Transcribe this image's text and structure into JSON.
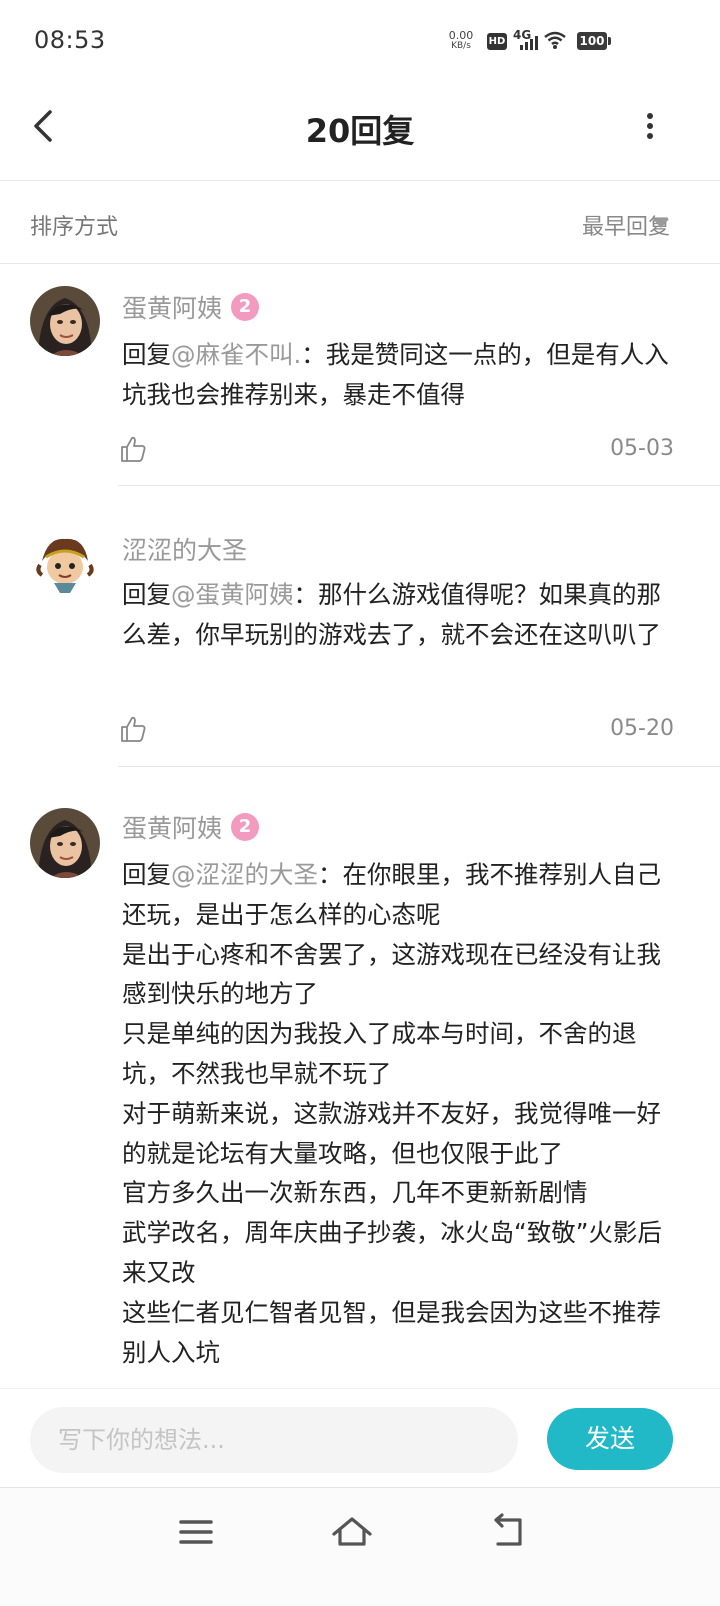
{
  "status_bar": {
    "time": "08:53",
    "net_speed_value": "0.00",
    "net_speed_unit": "KB/s",
    "hd": "HD",
    "network": "4G",
    "battery": "100"
  },
  "header": {
    "title": "20回复"
  },
  "sort": {
    "label": "排序方式",
    "selected": "最早回复"
  },
  "replies": [
    {
      "username": "蛋黄阿姨",
      "level": "2",
      "prefix": "回复",
      "mention": "@麻雀不叫.",
      "text": "：我是赞同这一点的，但是有人入坑我也会推荐别来，暴走不值得",
      "date": "05-03"
    },
    {
      "username": "涩涩的大圣",
      "prefix": "回复",
      "mention": "@蛋黄阿姨",
      "text": "：那什么游戏值得呢？如果真的那么差，你早玩别的游戏去了，就不会还在这叭叭了",
      "date": "05-20"
    },
    {
      "username": "蛋黄阿姨",
      "level": "2",
      "prefix": "回复",
      "mention": "@涩涩的大圣",
      "text": "：在你眼里，我不推荐别人自己还玩，是出于怎么样的心态呢\n是出于心疼和不舍罢了，这游戏现在已经没有让我感到快乐的地方了\n只是单纯的因为我投入了成本与时间，不舍的退坑，不然我也早就不玩了\n对于萌新来说，这款游戏并不友好，我觉得唯一好的就是论坛有大量攻略，但也仅限于此了\n官方多久出一次新东西，几年不更新新剧情\n武学改名，周年庆曲子抄袭，冰火岛“致敬”火影后来又改\n这些仁者见仁智者见智，但是我会因为这些不推荐别人入坑"
    }
  ],
  "composer": {
    "placeholder": "写下你的想法...",
    "send_label": "发送"
  },
  "colors": {
    "accent": "#21b8c8",
    "badge": "#f39ac0"
  },
  "icons": {
    "back": "chevron-left-icon",
    "more": "more-vertical-icon",
    "like": "thumbs-up-icon",
    "nav_menu": "menu-icon",
    "nav_home": "home-icon",
    "nav_back": "return-icon"
  }
}
